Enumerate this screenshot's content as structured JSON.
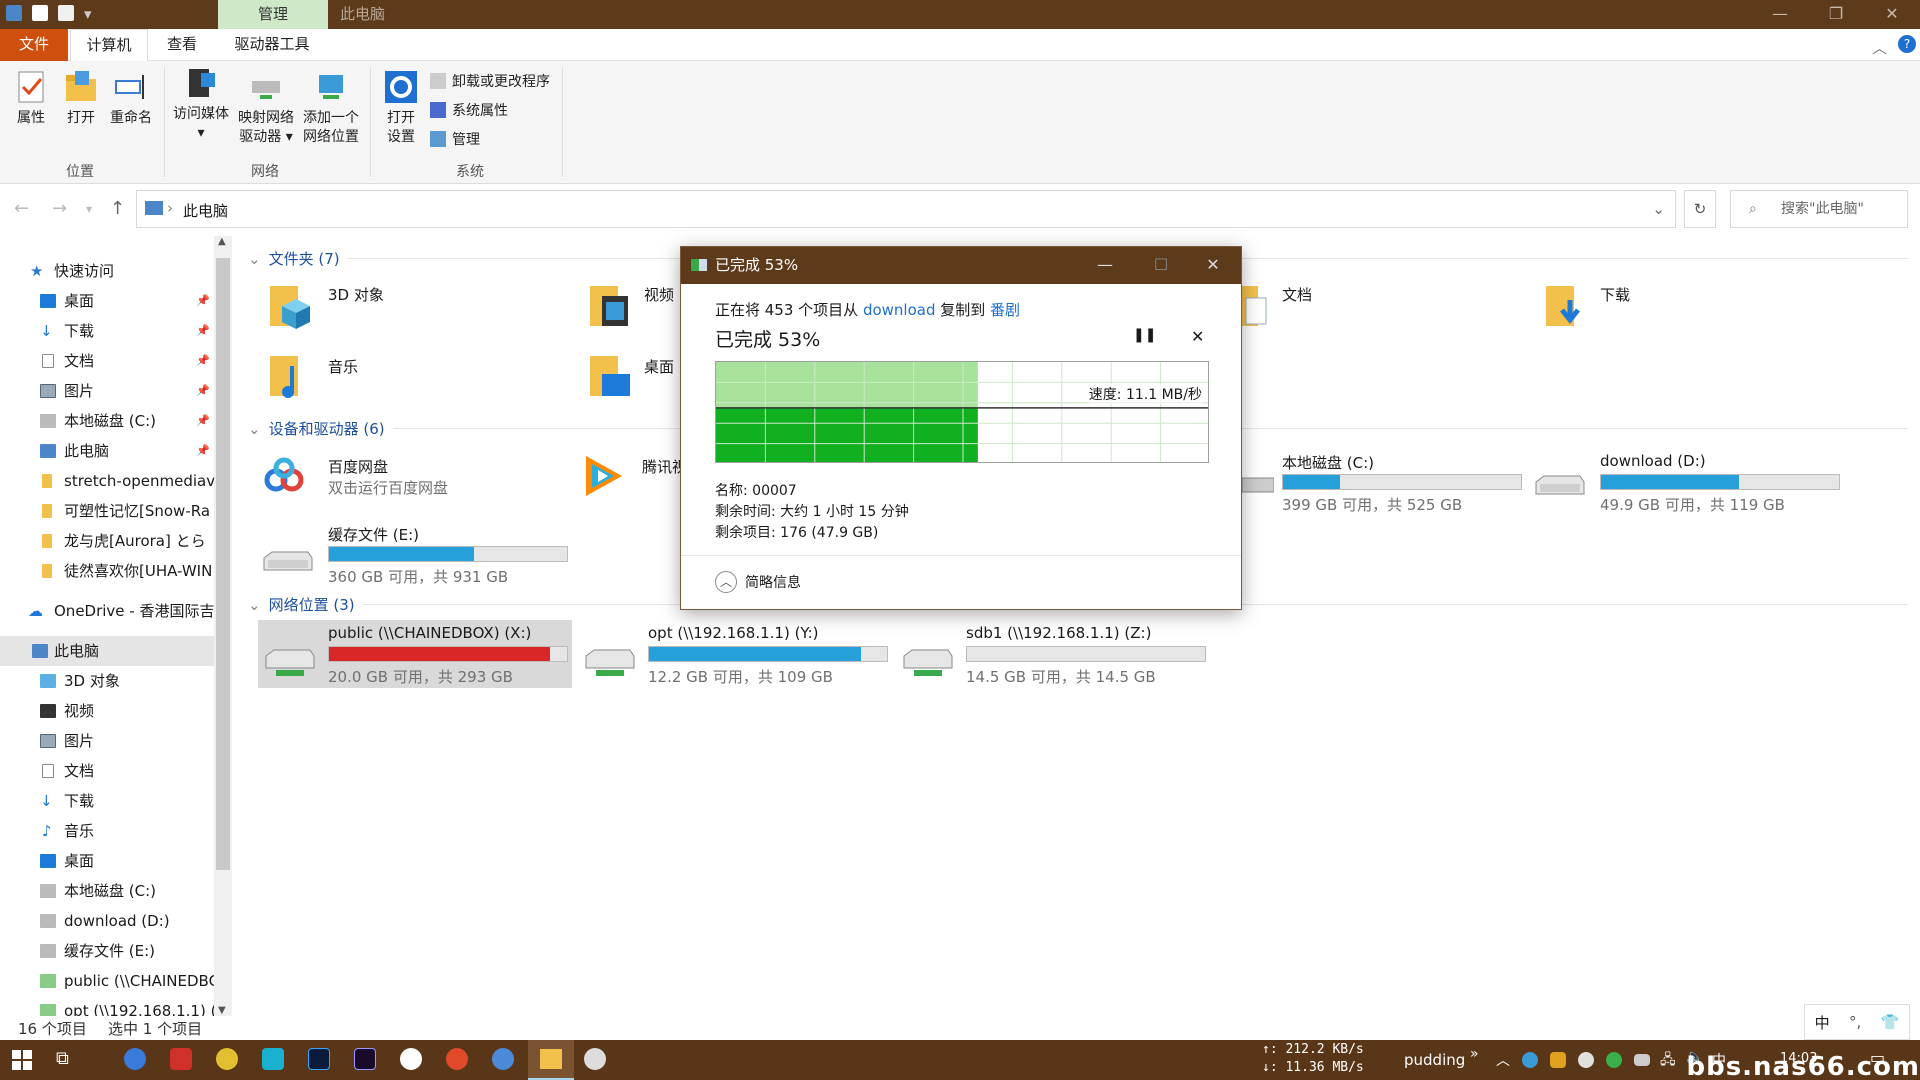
{
  "window": {
    "title": "此电脑",
    "context_tab": "管理"
  },
  "tabs": {
    "file": "文件",
    "computer": "计算机",
    "view": "查看",
    "drive_tools": "驱动器工具"
  },
  "ribbon": {
    "properties": "属性",
    "open": "打开",
    "rename": "重命名",
    "group_location": "位置",
    "access_media": "访问媒体",
    "map_drive_1": "映射网络",
    "map_drive_2": "驱动器",
    "add_loc_1": "添加一个",
    "add_loc_2": "网络位置",
    "group_network": "网络",
    "open_settings_1": "打开",
    "open_settings_2": "设置",
    "uninstall": "卸载或更改程序",
    "sys_props": "系统属性",
    "manage": "管理",
    "group_system": "系统"
  },
  "nav": {
    "path": "此电脑",
    "search_placeholder": "搜索\"此电脑\""
  },
  "sidebar": {
    "quick_access": "快速访问",
    "items": [
      "桌面",
      "下载",
      "文档",
      "图片",
      "本地磁盘 (C:)",
      "此电脑",
      "stretch-openmediav",
      "可塑性记忆[Snow-Ra",
      "龙与虎[Aurora] とら",
      "徒然喜欢你[UHA-WIN"
    ],
    "onedrive": "OneDrive - 香港国际吉",
    "this_pc": "此电脑",
    "pc_items": [
      "3D 对象",
      "视频",
      "图片",
      "文档",
      "下载",
      "音乐",
      "桌面",
      "本地磁盘 (C:)",
      "download (D:)",
      "缓存文件 (E:)",
      "public (\\\\CHAINEDBC",
      "opt (\\\\192.168.1.1) ("
    ]
  },
  "sections": {
    "folders": "文件夹 (7)",
    "devices": "设备和驱动器 (6)",
    "network": "网络位置 (3)"
  },
  "folders": [
    {
      "name": "3D 对象"
    },
    {
      "name": "视频"
    },
    {
      "name": "文档"
    },
    {
      "name": "下载"
    },
    {
      "name": "音乐"
    },
    {
      "name": "桌面"
    }
  ],
  "devices": {
    "baidu": {
      "name": "百度网盘",
      "desc": "双击运行百度网盘"
    },
    "tencent": {
      "name": "腾讯视"
    },
    "c": {
      "name": "本地磁盘 (C:)",
      "free": "399 GB 可用，共 525 GB",
      "used_fraction": 0.24
    },
    "d": {
      "name": "download (D:)",
      "free": "49.9 GB 可用，共 119 GB",
      "used_fraction": 0.58
    },
    "e": {
      "name": "缓存文件 (E:)",
      "free": "360 GB 可用，共 931 GB",
      "used_fraction": 0.61
    }
  },
  "network": {
    "x": {
      "name": "public (\\\\CHAINEDBOX) (X:)",
      "free": "20.0 GB 可用，共 293 GB",
      "used_fraction": 0.93
    },
    "y": {
      "name": "opt (\\\\192.168.1.1) (Y:)",
      "free": "12.2 GB 可用，共 109 GB",
      "used_fraction": 0.89
    },
    "z": {
      "name": "sdb1 (\\\\192.168.1.1) (Z:)",
      "free": "14.5 GB 可用，共 14.5 GB",
      "used_fraction": 0.0
    }
  },
  "status": {
    "count": "16 个项目",
    "selected": "选中 1 个项目"
  },
  "dialog": {
    "title": "已完成 53%",
    "line1_pre": "正在将 453 个项目从 ",
    "line1_src": "download",
    "line1_mid": " 复制到 ",
    "line1_dst": "番剧",
    "heading": "已完成 53%",
    "progress": 0.53,
    "speed": "速度: 11.1 MB/秒",
    "name": "名称: 00007",
    "remaining_time": "剩余时间: 大约 1 小时 15 分钟",
    "remaining_items": "剩余项目: 176 (47.9 GB)",
    "less_details": "简略信息"
  },
  "taskbar": {
    "net_up": "↑: 212.2 KB/s",
    "net_down": "↓: 11.36 MB/s",
    "user": "pudding",
    "ime": "中",
    "time": "14:03",
    "watermark": "bbs.nas66.com"
  },
  "ime_bar": {
    "lang": "中"
  }
}
